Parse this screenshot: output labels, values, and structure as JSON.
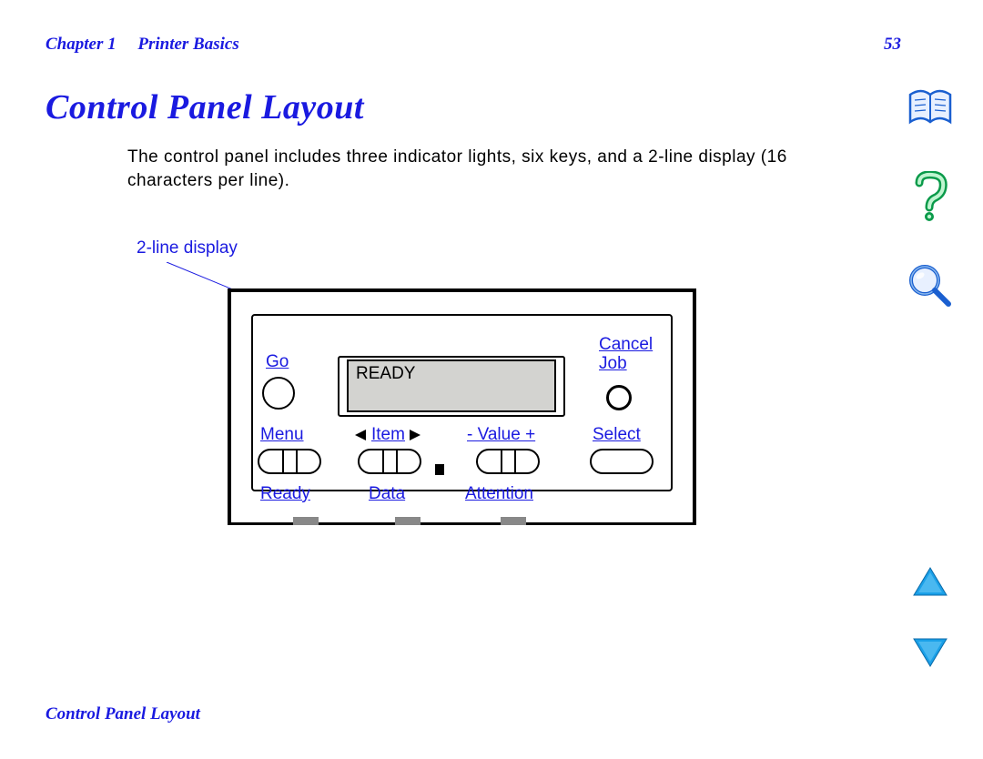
{
  "header": {
    "chapter_label": "Chapter 1",
    "chapter_title": "Printer Basics",
    "page_number": "53"
  },
  "title": "Control Panel Layout",
  "body": "The control panel includes three indicator lights, six keys, and a 2-line display (16 characters per line).",
  "callout": "2-line display",
  "panel": {
    "go": "Go",
    "cancel_job_line1": "Cancel",
    "cancel_job_line2": "Job",
    "lcd_text": "READY",
    "menu": "Menu",
    "item": "Item",
    "value": "- Value +",
    "select": "Select",
    "ready": "Ready",
    "data": "Data",
    "attention": "Attention"
  },
  "footer": "Control Panel Layout",
  "nav_icons": {
    "book": "book-icon",
    "help": "help-icon",
    "search": "search-icon",
    "up": "page-up",
    "down": "page-down"
  }
}
